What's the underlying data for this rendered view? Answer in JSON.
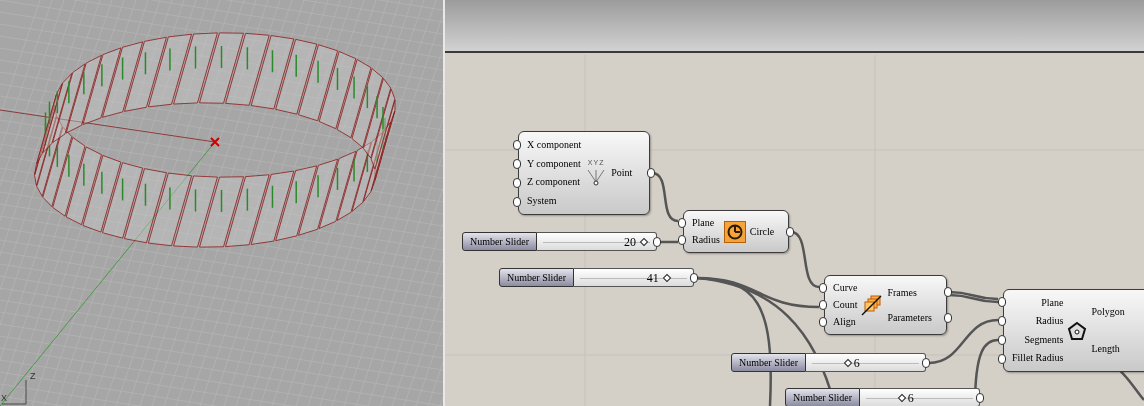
{
  "viewport": {
    "axis_labels": [
      "Z",
      "X"
    ]
  },
  "canvas": {
    "components": [
      {
        "kind": "point",
        "icon_label": "XYZ",
        "inputs": [
          "X component",
          "Y component",
          "Z component",
          "System"
        ],
        "outputs": [
          "Point"
        ]
      },
      {
        "kind": "circle",
        "inputs": [
          "Plane",
          "Radius"
        ],
        "outputs": [
          "Circle"
        ]
      },
      {
        "kind": "frames",
        "inputs": [
          "Curve",
          "Count",
          "Align"
        ],
        "outputs": [
          "Frames",
          "Parameters"
        ]
      },
      {
        "kind": "polygon",
        "inputs": [
          "Plane",
          "Radius",
          "Segments",
          "Fillet Radius"
        ],
        "outputs": [
          "Polygon",
          "Length"
        ]
      }
    ],
    "sliders": [
      {
        "label": "Number Slider",
        "value": "20",
        "level": 0.9
      },
      {
        "label": "Number Slider",
        "value": "41",
        "level": 0.78
      },
      {
        "label": "Number Slider",
        "value": "6",
        "level": 0.35
      },
      {
        "label": "Number Slider",
        "value": "6",
        "level": 0.35
      }
    ]
  }
}
